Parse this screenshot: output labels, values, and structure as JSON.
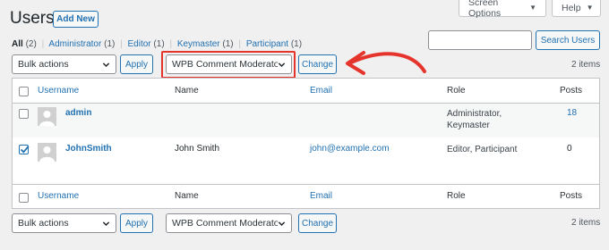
{
  "header": {
    "title": "Users",
    "add_new": "Add New"
  },
  "top_tabs": {
    "screen_options": "Screen Options",
    "help": "Help"
  },
  "filters": [
    {
      "label": "All",
      "count": "(2)"
    },
    {
      "label": "Administrator",
      "count": "(1)"
    },
    {
      "label": "Editor",
      "count": "(1)"
    },
    {
      "label": "Keymaster",
      "count": "(1)"
    },
    {
      "label": "Participant",
      "count": "(1)"
    }
  ],
  "search": {
    "value": "",
    "button": "Search Users"
  },
  "top_nav": {
    "bulk_actions": "Bulk actions",
    "apply": "Apply",
    "role_select": "WPB Comment Moderator",
    "change": "Change",
    "items": "2 items"
  },
  "bottom_nav": {
    "bulk_actions": "Bulk actions",
    "apply": "Apply",
    "role_select": "WPB Comment Moderator",
    "change": "Change",
    "items": "2 items"
  },
  "table": {
    "columns": {
      "username": "Username",
      "name": "Name",
      "email": "Email",
      "role": "Role",
      "posts": "Posts"
    },
    "rows": [
      {
        "username": "admin",
        "name": "",
        "email": "",
        "role_line1": "Administrator,",
        "role_line2": "Keymaster",
        "posts": "18",
        "checked": false
      },
      {
        "username": "JohnSmith",
        "name": "John Smith",
        "email": "john@example.com",
        "role_line1": "Editor, Participant",
        "role_line2": "",
        "posts": "0",
        "checked": true
      }
    ]
  },
  "colors": {
    "accent": "#2271b1",
    "highlight": "#e5342c",
    "background": "#f0f0f1"
  }
}
